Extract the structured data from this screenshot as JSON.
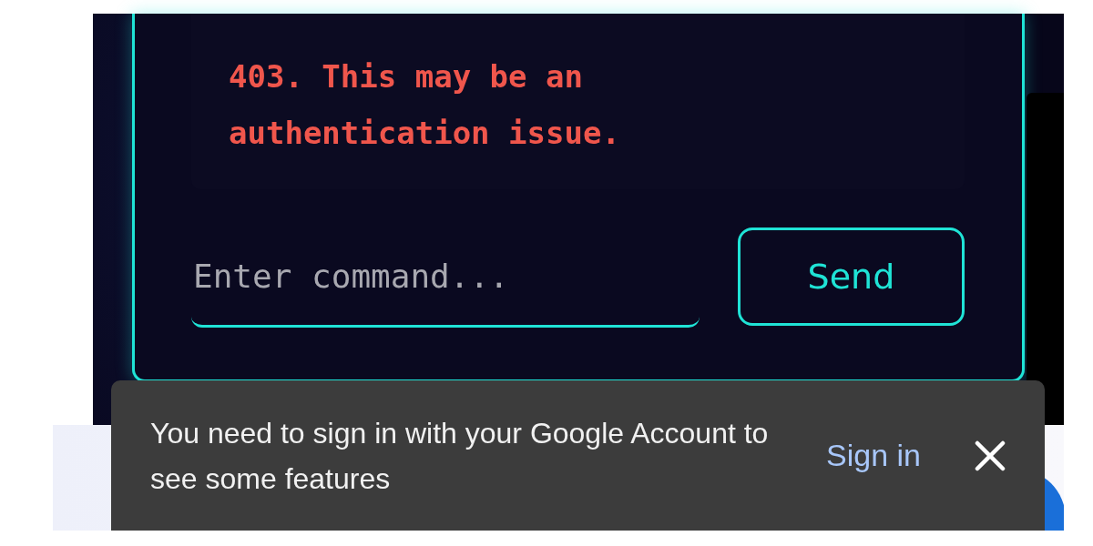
{
  "terminal": {
    "error_message": "403. This may be an authentication issue.",
    "command_field": {
      "placeholder": "Enter command..."
    },
    "send_button": "Send"
  },
  "snackbar": {
    "message": "You need to sign in with your Google Account to see some features",
    "action": "Sign in"
  }
}
